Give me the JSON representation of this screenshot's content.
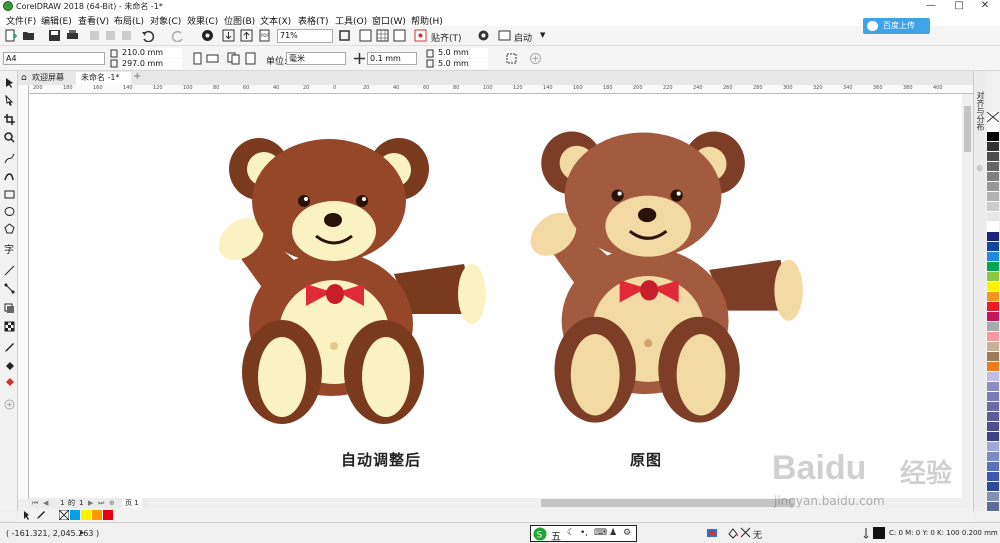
{
  "window": {
    "title": "CorelDRAW 2018 (64-Bit) - 未命名 -1*",
    "controls": [
      "—",
      "□",
      "✕"
    ]
  },
  "menu": [
    "文件(F)",
    "编辑(E)",
    "查看(V)",
    "布局(L)",
    "对象(C)",
    "效果(C)",
    "位图(B)",
    "文本(X)",
    "表格(T)",
    "工具(O)",
    "窗口(W)",
    "帮助(H)"
  ],
  "cloud_button": "百度上传",
  "toolbar": {
    "zoom": "71%",
    "snap_label": "贴齐(T)",
    "launch_label": "启动"
  },
  "property_bar": {
    "page_size": "A4",
    "width": "210.0 mm",
    "height": "297.0 mm",
    "unit_label": "单位:",
    "unit": "毫米",
    "nudge": "0.1 mm",
    "dup_x": "5.0 mm",
    "dup_y": "5.0 mm"
  },
  "tabs": [
    {
      "label": "欢迎屏幕"
    },
    {
      "label": "未命名 -1*"
    }
  ],
  "ruler_ticks": [
    "200",
    "180",
    "160",
    "140",
    "120",
    "100",
    "80",
    "60",
    "40",
    "20",
    "0",
    "20",
    "40",
    "60",
    "80",
    "100",
    "120",
    "140",
    "160",
    "180",
    "200",
    "220",
    "240",
    "260",
    "280",
    "300",
    "320",
    "340",
    "360",
    "380",
    "400"
  ],
  "canvas": {
    "caption_left": "自动调整后",
    "caption_right": "原图"
  },
  "page_nav": {
    "current": "1",
    "of": "的",
    "total": "1",
    "page_tab": "页 1"
  },
  "docker_label": "对齐与分布",
  "palette_colors": [
    "#ffffff",
    "#000000",
    "#333333",
    "#4d4d4d",
    "#666666",
    "#808080",
    "#999999",
    "#b3b3b3",
    "#cccccc",
    "#e6e6e6",
    "#ffffff",
    "#1a237e",
    "#0d47a1",
    "#1e88e5",
    "#00a651",
    "#8dc63f",
    "#fff200",
    "#f7941d",
    "#ed1c24",
    "#c2185b",
    "#a7a9ac",
    "#f6989d",
    "#c7b299",
    "#9e7b5f",
    "#ea7c1e",
    "#bdbde6",
    "#8c8cc2",
    "#7b7bb5",
    "#6a6aa8",
    "#5c5c9c",
    "#4e4e90",
    "#404084",
    "#9ea7d6",
    "#7b8bc9",
    "#5a70bc",
    "#3d58ad",
    "#2f4a9c",
    "#8290b8",
    "#5d6b9a"
  ],
  "document_palette": [
    "#00a0e9",
    "#fff100",
    "#ff9900",
    "#e60012"
  ],
  "status": {
    "coords": "( -161.321, 2,045.263 )",
    "ime_label": "五",
    "fill_label": "无",
    "outline_info": "C: 0 M: 0 Y: 0 K: 100  0.200 mm"
  },
  "watermark": {
    "brand": "Baidu",
    "sub": "经验",
    "url": "jingyan.baidu.com"
  },
  "colors": {
    "bear_fur_dark": "#7a3a1e",
    "bear_fur_mid": "#96472a",
    "bear_fur_orig": "#a35b3f",
    "bear_fur_orig_dark": "#7d3e27",
    "bear_cream": "#fbf2c4",
    "bear_cream_orig": "#f3d9a4",
    "bow_red": "#e02a37",
    "cloud_button": "#3fa3e8"
  }
}
